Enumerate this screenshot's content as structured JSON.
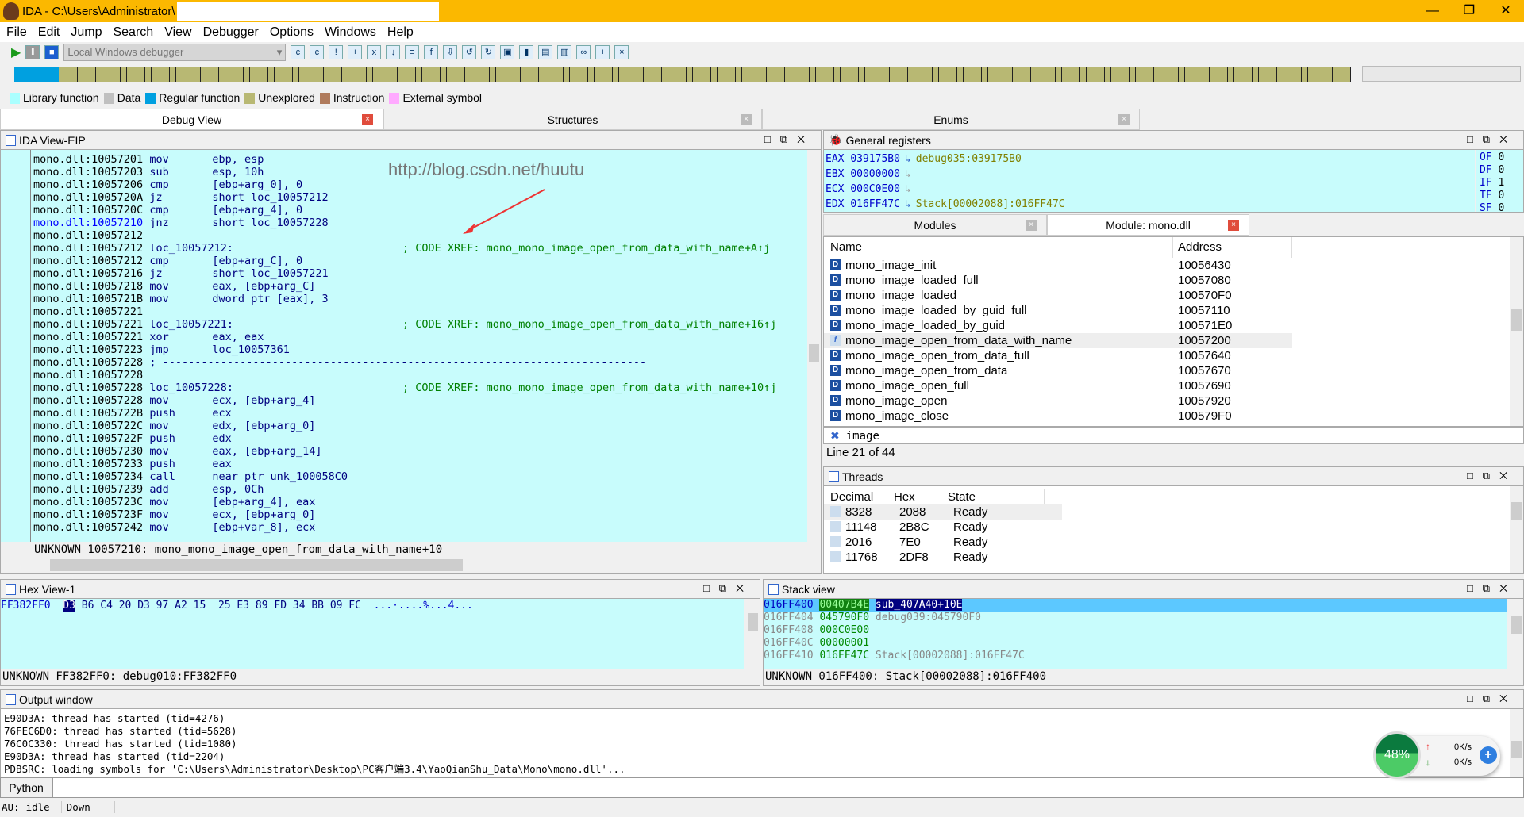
{
  "window": {
    "title": "IDA - C:\\Users\\Administrator\\",
    "min": "—",
    "max": "❐",
    "close": "✕"
  },
  "menu": [
    "File",
    "Edit",
    "Jump",
    "Search",
    "View",
    "Debugger",
    "Options",
    "Windows",
    "Help"
  ],
  "toolbar": {
    "debugger_select": "Local Windows debugger"
  },
  "legend": [
    {
      "label": "Library function",
      "color": "#aaffff"
    },
    {
      "label": "Data",
      "color": "#c0c0c0"
    },
    {
      "label": "Regular function",
      "color": "#00a0e0"
    },
    {
      "label": "Unexplored",
      "color": "#b8b873"
    },
    {
      "label": "Instruction",
      "color": "#b07b5c"
    },
    {
      "label": "External symbol",
      "color": "#ffaaff"
    }
  ],
  "tabs": [
    "Debug View",
    "Structures",
    "Enums"
  ],
  "ida_view": {
    "title": "IDA View-EIP",
    "watermark": "http://blog.csdn.net/huutu",
    "lines": [
      {
        "a": "mono.dll:10057201",
        "m": "mov",
        "o": "ebp, esp"
      },
      {
        "a": "mono.dll:10057203",
        "m": "sub",
        "o": "esp, 10h"
      },
      {
        "a": "mono.dll:10057206",
        "m": "cmp",
        "o": "[ebp+arg_0], 0"
      },
      {
        "a": "mono.dll:1005720A",
        "m": "jz",
        "o": "short loc_10057212"
      },
      {
        "a": "mono.dll:1005720C",
        "m": "cmp",
        "o": "[ebp+arg_4], 0"
      },
      {
        "a": "mono.dll:10057210",
        "m": "jnz",
        "o": "short loc_10057228",
        "cur": true
      },
      {
        "a": "mono.dll:10057212",
        "m": "",
        "o": ""
      },
      {
        "a": "mono.dll:10057212",
        "m": "loc_10057212:",
        "o": "",
        "c": "; CODE XREF: mono_mono_image_open_from_data_with_name+A↑j"
      },
      {
        "a": "mono.dll:10057212",
        "m": "cmp",
        "o": "[ebp+arg_C], 0"
      },
      {
        "a": "mono.dll:10057216",
        "m": "jz",
        "o": "short loc_10057221"
      },
      {
        "a": "mono.dll:10057218",
        "m": "mov",
        "o": "eax, [ebp+arg_C]"
      },
      {
        "a": "mono.dll:1005721B",
        "m": "mov",
        "o": "dword ptr [eax], 3"
      },
      {
        "a": "mono.dll:10057221",
        "m": "",
        "o": ""
      },
      {
        "a": "mono.dll:10057221",
        "m": "loc_10057221:",
        "o": "",
        "c": "; CODE XREF: mono_mono_image_open_from_data_with_name+16↑j"
      },
      {
        "a": "mono.dll:10057221",
        "m": "xor",
        "o": "eax, eax"
      },
      {
        "a": "mono.dll:10057223",
        "m": "jmp",
        "o": "loc_10057361"
      },
      {
        "a": "mono.dll:10057228",
        "m": "; ---------------------------------------------------------------------------",
        "o": ""
      },
      {
        "a": "mono.dll:10057228",
        "m": "",
        "o": ""
      },
      {
        "a": "mono.dll:10057228",
        "m": "loc_10057228:",
        "o": "",
        "c": "; CODE XREF: mono_mono_image_open_from_data_with_name+10↑j"
      },
      {
        "a": "mono.dll:10057228",
        "m": "mov",
        "o": "ecx, [ebp+arg_4]"
      },
      {
        "a": "mono.dll:1005722B",
        "m": "push",
        "o": "ecx"
      },
      {
        "a": "mono.dll:1005722C",
        "m": "mov",
        "o": "edx, [ebp+arg_0]"
      },
      {
        "a": "mono.dll:1005722F",
        "m": "push",
        "o": "edx"
      },
      {
        "a": "mono.dll:10057230",
        "m": "mov",
        "o": "eax, [ebp+arg_14]"
      },
      {
        "a": "mono.dll:10057233",
        "m": "push",
        "o": "eax"
      },
      {
        "a": "mono.dll:10057234",
        "m": "call",
        "o": "near ptr unk_100058C0"
      },
      {
        "a": "mono.dll:10057239",
        "m": "add",
        "o": "esp, 0Ch"
      },
      {
        "a": "mono.dll:1005723C",
        "m": "mov",
        "o": "[ebp+arg_4], eax"
      },
      {
        "a": "mono.dll:1005723F",
        "m": "mov",
        "o": "ecx, [ebp+arg_0]"
      },
      {
        "a": "mono.dll:10057242",
        "m": "mov",
        "o": "[ebp+var_8], ecx"
      }
    ],
    "status": "UNKNOWN 10057210: mono_mono_image_open_from_data_with_name+10"
  },
  "registers": {
    "title": "General registers",
    "rows": [
      {
        "name": "EAX",
        "value": "039175B0",
        "ref": "debug035:039175B0"
      },
      {
        "name": "EBX",
        "value": "00000000",
        "ref": ""
      },
      {
        "name": "ECX",
        "value": "000C0E00",
        "ref": ""
      },
      {
        "name": "EDX",
        "value": "016FF47C",
        "ref": "Stack[00002088]:016FF47C"
      }
    ],
    "flags": [
      {
        "n": "OF",
        "v": "0"
      },
      {
        "n": "DF",
        "v": "0"
      },
      {
        "n": "IF",
        "v": "1"
      },
      {
        "n": "TF",
        "v": "0"
      },
      {
        "n": "SF",
        "v": "0"
      }
    ]
  },
  "module_tabs": [
    "Modules",
    "Module: mono.dll"
  ],
  "modules": {
    "headers": [
      "Name",
      "Address"
    ],
    "rows": [
      {
        "name": "mono_image_init",
        "addr": "10056430",
        "t": "D"
      },
      {
        "name": "mono_image_loaded_full",
        "addr": "10057080",
        "t": "D"
      },
      {
        "name": "mono_image_loaded",
        "addr": "100570F0",
        "t": "D"
      },
      {
        "name": "mono_image_loaded_by_guid_full",
        "addr": "10057110",
        "t": "D"
      },
      {
        "name": "mono_image_loaded_by_guid",
        "addr": "100571E0",
        "t": "D"
      },
      {
        "name": "mono_image_open_from_data_with_name",
        "addr": "10057200",
        "t": "f",
        "sel": true
      },
      {
        "name": "mono_image_open_from_data_full",
        "addr": "10057640",
        "t": "D"
      },
      {
        "name": "mono_image_open_from_data",
        "addr": "10057670",
        "t": "D"
      },
      {
        "name": "mono_image_open_full",
        "addr": "10057690",
        "t": "D"
      },
      {
        "name": "mono_image_open",
        "addr": "10057920",
        "t": "D"
      },
      {
        "name": "mono_image_close",
        "addr": "100579F0",
        "t": "D"
      }
    ],
    "filter": "image",
    "line_info": "Line 21 of 44"
  },
  "threads": {
    "title": "Threads",
    "headers": [
      "Decimal",
      "Hex",
      "State"
    ],
    "rows": [
      [
        "8328",
        "2088",
        "Ready"
      ],
      [
        "11148",
        "2B8C",
        "Ready"
      ],
      [
        "2016",
        "7E0",
        "Ready"
      ],
      [
        "11768",
        "2DF8",
        "Ready"
      ]
    ]
  },
  "hex": {
    "title": "Hex View-1",
    "addr": "FF382FF0",
    "first": "D3",
    "bytes": "B6 C4 20 D3 97 A2 15  25 E3 89 FD 34 BB 09 FC",
    "ascii": "...·....%...4...",
    "status": "UNKNOWN FF382FF0: debug010:FF382FF0"
  },
  "stack": {
    "title": "Stack view",
    "rows": [
      {
        "a": "016FF400",
        "v": "00407B4E",
        "r": "sub_407A40+10E",
        "sel": true
      },
      {
        "a": "016FF404",
        "v": "045790F0",
        "r": "debug039:045790F0"
      },
      {
        "a": "016FF408",
        "v": "000C0E00",
        "r": ""
      },
      {
        "a": "016FF40C",
        "v": "00000001",
        "r": ""
      },
      {
        "a": "016FF410",
        "v": "016FF47C",
        "r": "Stack[00002088]:016FF47C"
      }
    ],
    "status": "UNKNOWN 016FF400: Stack[00002088]:016FF400"
  },
  "output": {
    "title": "Output window",
    "lines": [
      "E90D3A: thread has started (tid=4276)",
      "76FEC6D0: thread has started (tid=5628)",
      "76C0C330: thread has started (tid=1080)",
      "E90D3A: thread has started (tid=2204)",
      "PDBSRC: loading symbols for 'C:\\Users\\Administrator\\Desktop\\PC客户端3.4\\YaoQianShu_Data\\Mono\\mono.dll'..."
    ]
  },
  "python_label": "Python",
  "statusbar": {
    "au": "AU:",
    "state": "idle",
    "dir": "Down"
  },
  "net_widget": {
    "percent": "48%",
    "up": "0K/s",
    "down": "0K/s"
  }
}
